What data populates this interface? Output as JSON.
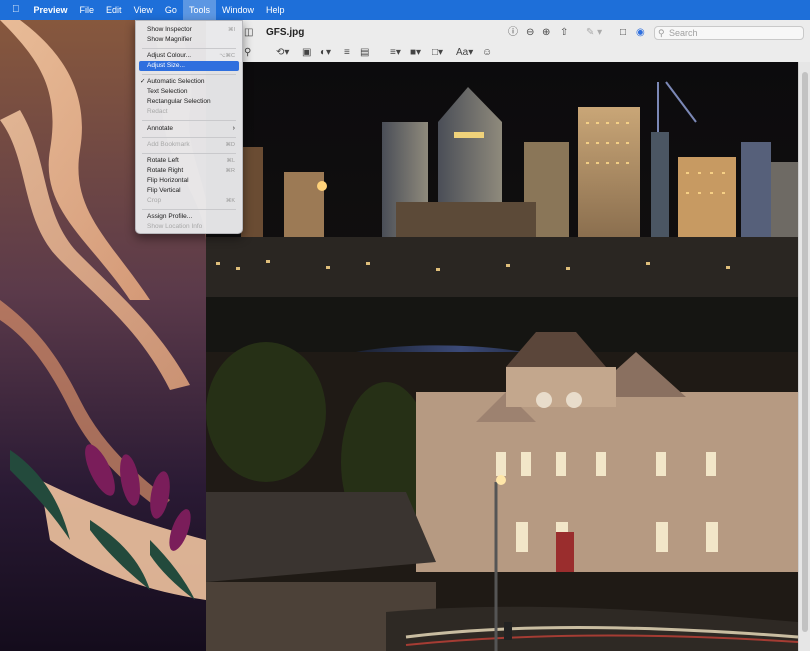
{
  "menubar": {
    "apple_icon": "apple-logo-icon",
    "app_name": "Preview",
    "menus": [
      "File",
      "Edit",
      "View",
      "Go",
      "Tools",
      "Window",
      "Help"
    ],
    "active_menu": "Tools"
  },
  "window": {
    "title": "GFS.jpg",
    "search_placeholder": "Search",
    "toolbar_icons": [
      "sidebar-icon",
      "zoom-icon",
      "rotate-icon",
      "crop-icon",
      "adjust-color-icon",
      "sign-icon",
      "note-icon",
      "info-icon",
      "zoom-out-icon",
      "zoom-in-icon",
      "share-icon",
      "markup-icon",
      "rotate-button-icon",
      "markup-toolbar-icon",
      "search-icon"
    ],
    "image_subject": "Brisbane city skyline at night with heritage building"
  },
  "tools_menu": {
    "items": [
      {
        "label": "Show Inspector",
        "shortcut": "⌘I",
        "enabled": true
      },
      {
        "label": "Show Magnifier",
        "shortcut": "",
        "enabled": true
      },
      {
        "label": "Adjust Colour...",
        "shortcut": "⌥⌘C",
        "enabled": true
      },
      {
        "label": "Adjust Size...",
        "shortcut": "",
        "enabled": true,
        "highlighted": true
      },
      {
        "label": "Automatic Selection",
        "shortcut": "",
        "enabled": true,
        "checked": true
      },
      {
        "label": "Text Selection",
        "shortcut": "",
        "enabled": true
      },
      {
        "label": "Rectangular Selection",
        "shortcut": "",
        "enabled": true
      },
      {
        "label": "Redact",
        "shortcut": "",
        "enabled": false
      },
      {
        "label": "Annotate",
        "shortcut": "",
        "enabled": true,
        "submenu": true
      },
      {
        "label": "Add Bookmark",
        "shortcut": "⌘D",
        "enabled": false
      },
      {
        "label": "Rotate Left",
        "shortcut": "⌘L",
        "enabled": true
      },
      {
        "label": "Rotate Right",
        "shortcut": "⌘R",
        "enabled": true
      },
      {
        "label": "Flip Horizontal",
        "shortcut": "",
        "enabled": true
      },
      {
        "label": "Flip Vertical",
        "shortcut": "",
        "enabled": true
      },
      {
        "label": "Crop",
        "shortcut": "⌘K",
        "enabled": false
      },
      {
        "label": "Assign Profile...",
        "shortcut": "",
        "enabled": true
      },
      {
        "label": "Show Location Info",
        "shortcut": "",
        "enabled": false
      }
    ]
  },
  "colors": {
    "menubar": "#1e6fd9",
    "highlight": "#2f6fde",
    "window_chrome": "#ececec"
  }
}
